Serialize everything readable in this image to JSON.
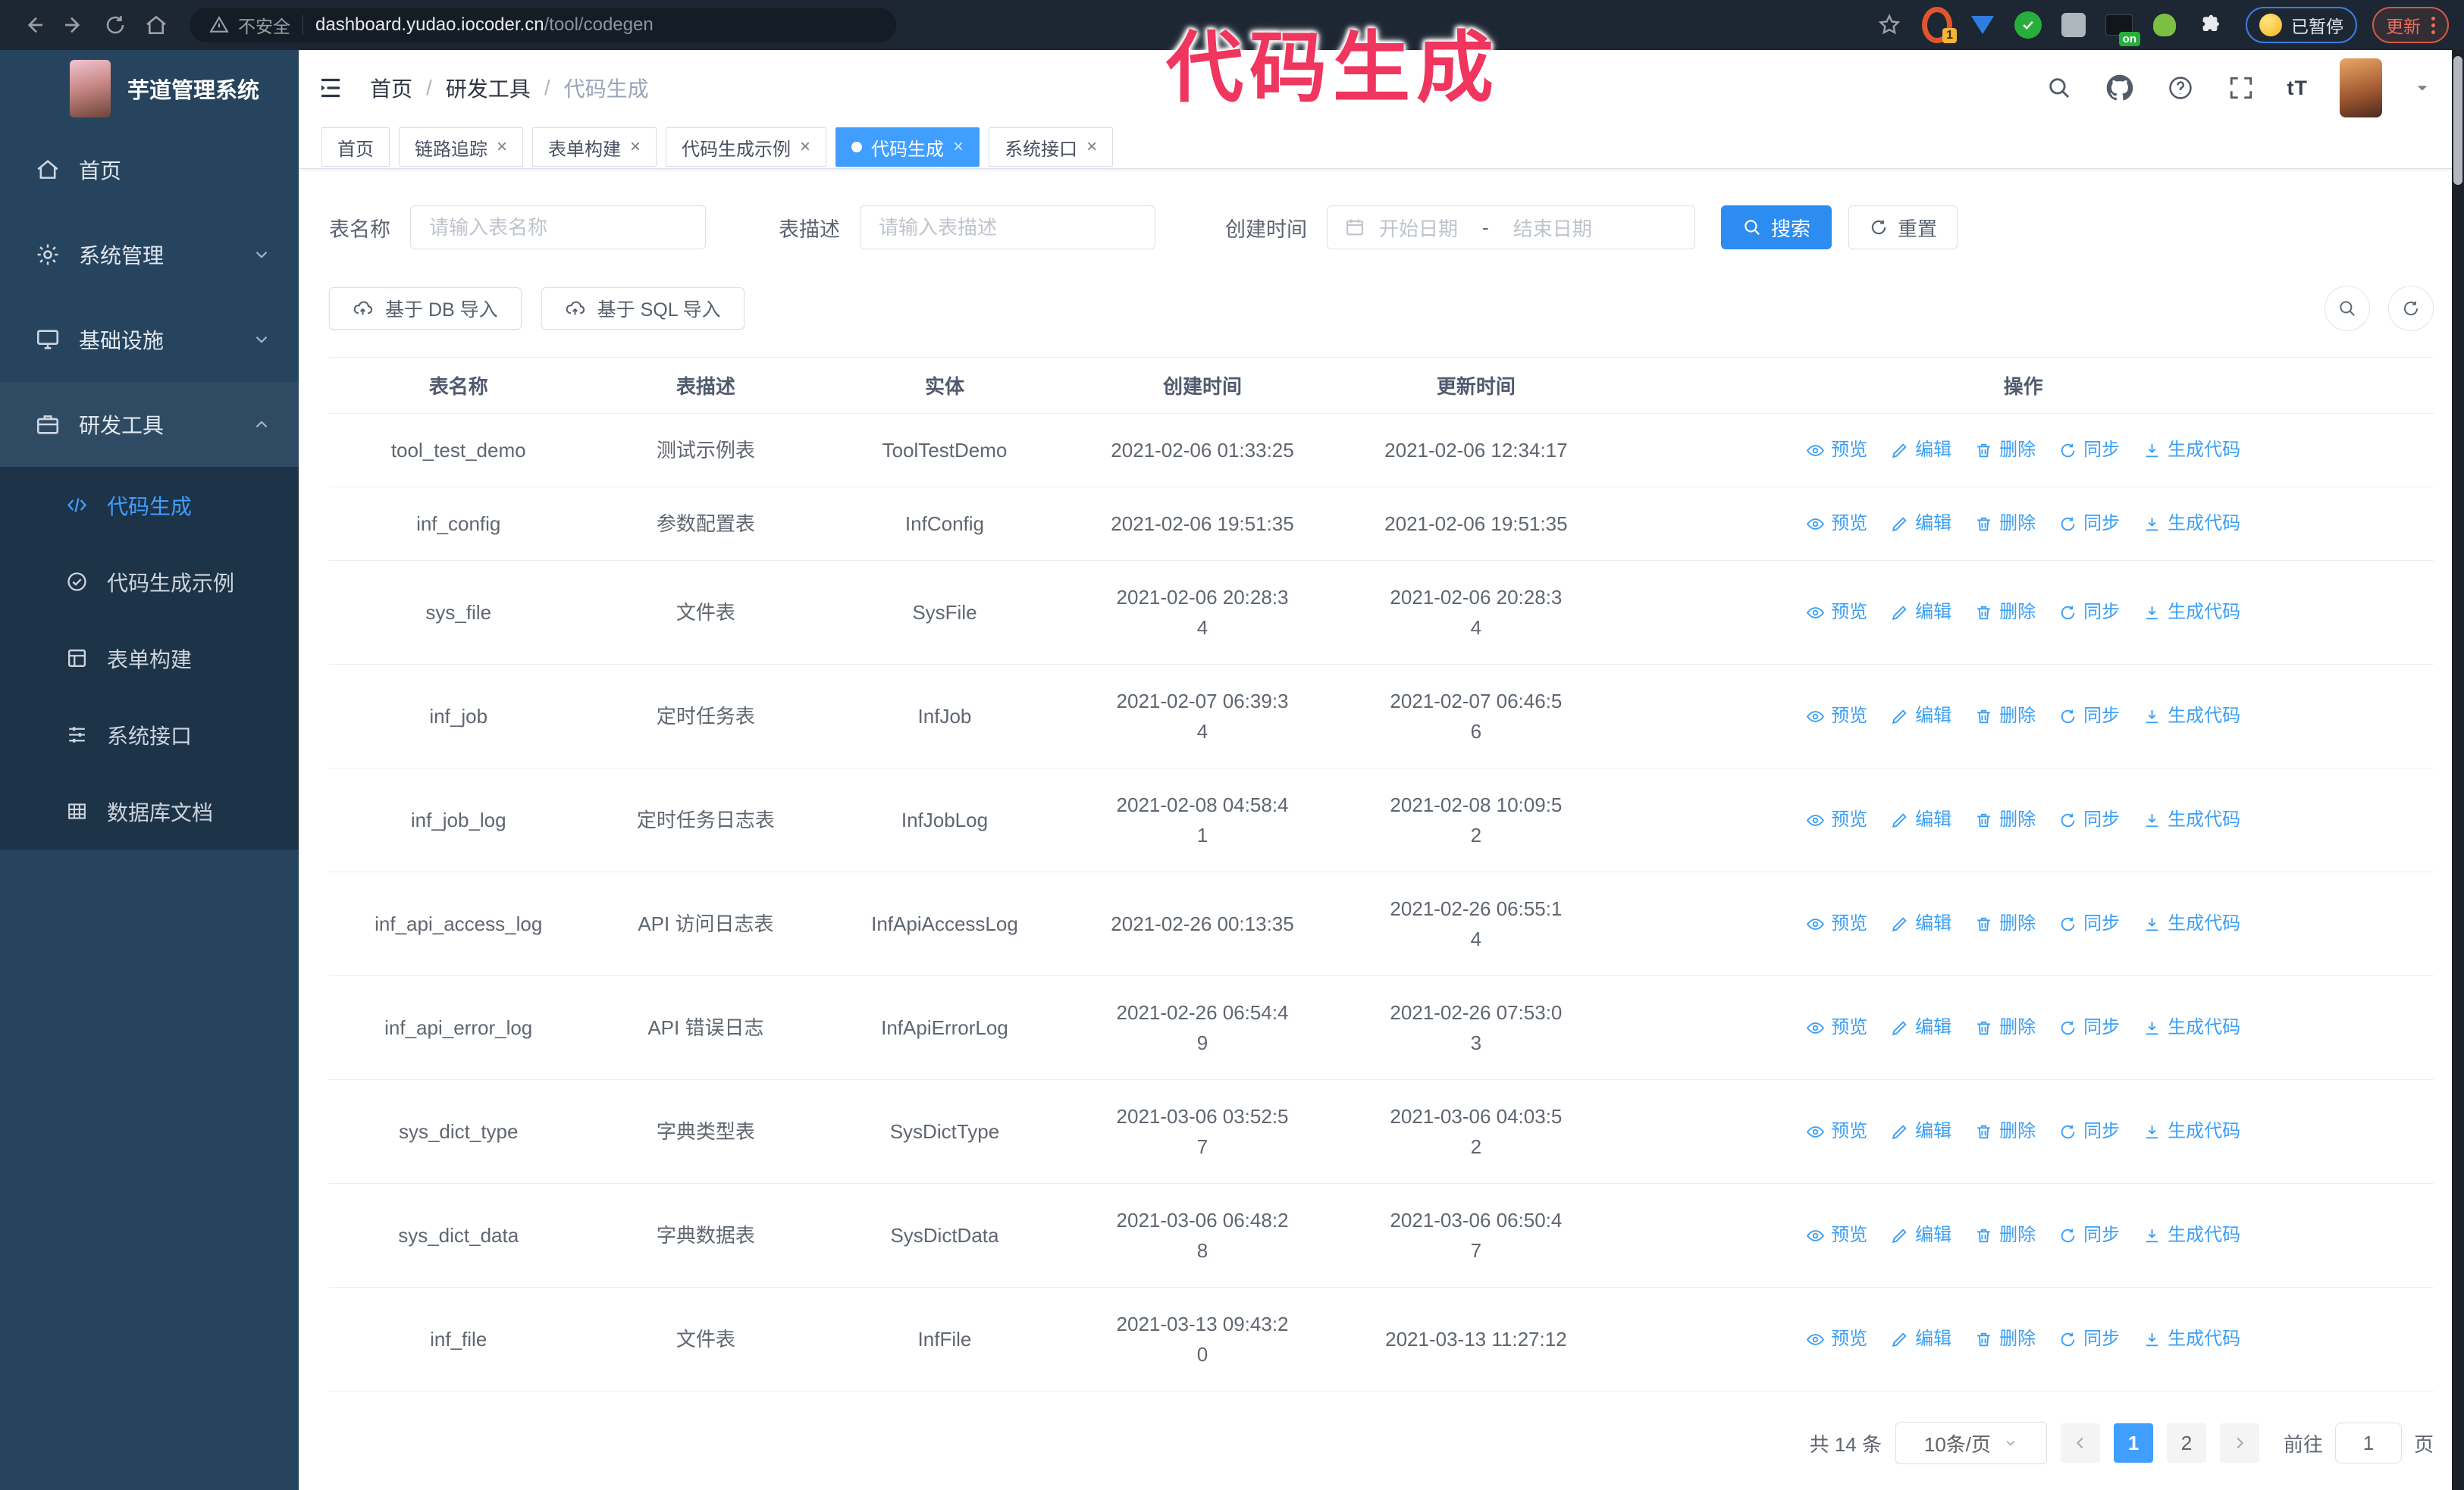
{
  "browser": {
    "security_label": "不安全",
    "url_host": "dashboard.yudao.iocoder.cn",
    "url_path": "/tool/codegen",
    "ext_badge": "1",
    "on_badge": "on",
    "paused_label": "已暂停",
    "update_label": "更新"
  },
  "watermark": {
    "text": "代码生成",
    "color": "#f0355e"
  },
  "sidebar": {
    "app_title": "芋道管理系统",
    "items": [
      {
        "label": "首页",
        "icon": "home-icon",
        "chevron": "",
        "expanded": false
      },
      {
        "label": "系统管理",
        "icon": "gear-icon",
        "chevron": "down",
        "expanded": false
      },
      {
        "label": "基础设施",
        "icon": "infrastructure-icon",
        "chevron": "down",
        "expanded": false
      },
      {
        "label": "研发工具",
        "icon": "toolbox-icon",
        "chevron": "up",
        "expanded": true
      }
    ],
    "submenu": [
      {
        "label": "代码生成",
        "icon": "code-icon",
        "active": true
      },
      {
        "label": "代码生成示例",
        "icon": "example-icon",
        "active": false
      },
      {
        "label": "表单构建",
        "icon": "form-icon",
        "active": false
      },
      {
        "label": "系统接口",
        "icon": "api-icon",
        "active": false
      },
      {
        "label": "数据库文档",
        "icon": "database-icon",
        "active": false
      }
    ]
  },
  "header": {
    "breadcrumb": [
      "首页",
      "研发工具",
      "代码生成"
    ]
  },
  "tabs": [
    {
      "label": "首页",
      "closable": false,
      "active": false
    },
    {
      "label": "链路追踪",
      "closable": true,
      "active": false
    },
    {
      "label": "表单构建",
      "closable": true,
      "active": false
    },
    {
      "label": "代码生成示例",
      "closable": true,
      "active": false
    },
    {
      "label": "代码生成",
      "closable": true,
      "active": true
    },
    {
      "label": "系统接口",
      "closable": true,
      "active": false
    }
  ],
  "search": {
    "name_label": "表名称",
    "name_placeholder": "请输入表名称",
    "desc_label": "表描述",
    "desc_placeholder": "请输入表描述",
    "time_label": "创建时间",
    "start_placeholder": "开始日期",
    "separator": "-",
    "end_placeholder": "结束日期",
    "search_button": "搜索",
    "reset_button": "重置"
  },
  "toolbar": {
    "import_db": "基于 DB 导入",
    "import_sql": "基于 SQL 导入"
  },
  "table": {
    "columns": [
      "表名称",
      "表描述",
      "实体",
      "创建时间",
      "更新时间",
      "操作"
    ],
    "actions": [
      {
        "label": "预览",
        "icon": "eye-icon"
      },
      {
        "label": "编辑",
        "icon": "edit-icon"
      },
      {
        "label": "删除",
        "icon": "trash-icon"
      },
      {
        "label": "同步",
        "icon": "sync-icon"
      },
      {
        "label": "生成代码",
        "icon": "download-icon"
      }
    ],
    "rows": [
      {
        "name": "tool_test_demo",
        "desc": "测试示例表",
        "entity": "ToolTestDemo",
        "created": "2021-02-06 01:33:25",
        "updated": "2021-02-06 12:34:17",
        "created_wrap": false,
        "updated_wrap": false
      },
      {
        "name": "inf_config",
        "desc": "参数配置表",
        "entity": "InfConfig",
        "created": "2021-02-06 19:51:35",
        "updated": "2021-02-06 19:51:35",
        "created_wrap": false,
        "updated_wrap": false
      },
      {
        "name": "sys_file",
        "desc": "文件表",
        "entity": "SysFile",
        "created": "2021-02-06 20:28:34",
        "updated": "2021-02-06 20:28:34",
        "created_wrap": true,
        "updated_wrap": true
      },
      {
        "name": "inf_job",
        "desc": "定时任务表",
        "entity": "InfJob",
        "created": "2021-02-07 06:39:34",
        "updated": "2021-02-07 06:46:56",
        "created_wrap": true,
        "updated_wrap": true
      },
      {
        "name": "inf_job_log",
        "desc": "定时任务日志表",
        "entity": "InfJobLog",
        "created": "2021-02-08 04:58:41",
        "updated": "2021-02-08 10:09:52",
        "created_wrap": true,
        "updated_wrap": true
      },
      {
        "name": "inf_api_access_log",
        "desc": "API 访问日志表",
        "entity": "InfApiAccessLog",
        "created": "2021-02-26 00:13:35",
        "updated": "2021-02-26 06:55:14",
        "created_wrap": false,
        "updated_wrap": true
      },
      {
        "name": "inf_api_error_log",
        "desc": "API 错误日志",
        "entity": "InfApiErrorLog",
        "created": "2021-02-26 06:54:49",
        "updated": "2021-02-26 07:53:03",
        "created_wrap": true,
        "updated_wrap": true
      },
      {
        "name": "sys_dict_type",
        "desc": "字典类型表",
        "entity": "SysDictType",
        "created": "2021-03-06 03:52:57",
        "updated": "2021-03-06 04:03:52",
        "created_wrap": true,
        "updated_wrap": true
      },
      {
        "name": "sys_dict_data",
        "desc": "字典数据表",
        "entity": "SysDictData",
        "created": "2021-03-06 06:48:28",
        "updated": "2021-03-06 06:50:47",
        "created_wrap": true,
        "updated_wrap": true
      },
      {
        "name": "inf_file",
        "desc": "文件表",
        "entity": "InfFile",
        "created": "2021-03-13 09:43:20",
        "updated": "2021-03-13 11:27:12",
        "created_wrap": true,
        "updated_wrap": false
      }
    ]
  },
  "pagination": {
    "total": "共 14 条",
    "page_size": "10条/页",
    "pages": [
      "1",
      "2"
    ],
    "active_page": "1",
    "goto_label": "前往",
    "goto_value": "1",
    "page_label": "页"
  },
  "colors": {
    "accent": "#409eff",
    "search_button": "#2d8cf0",
    "sidebar_bg": "#27445e",
    "submenu_bg": "#1d3348",
    "watermark": "#f0355e"
  }
}
